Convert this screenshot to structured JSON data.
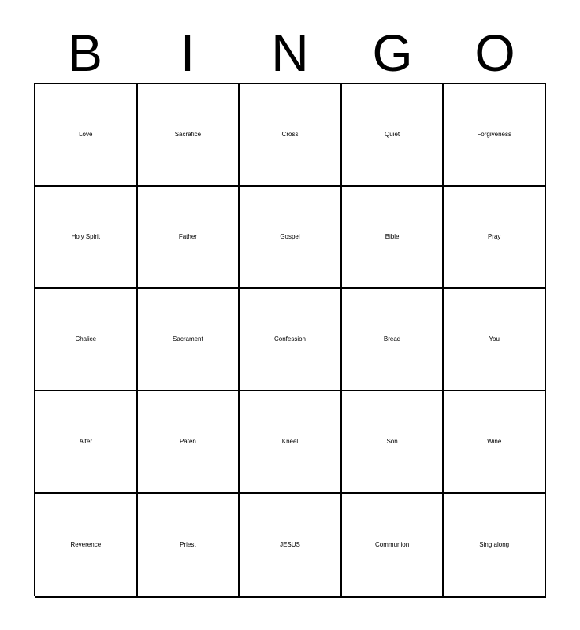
{
  "card": {
    "header_letters": [
      "B",
      "I",
      "N",
      "G",
      "O"
    ],
    "columns": 5,
    "rows": 5,
    "background_color": "#ffffff",
    "border_color": "#000000",
    "text_color": "#000000",
    "cells": [
      [
        {
          "text": "Love",
          "size": "xxl"
        },
        {
          "text": "Sacrafice",
          "size": "sm"
        },
        {
          "text": "Cross",
          "size": "xl"
        },
        {
          "text": "Quiet",
          "size": "xl"
        },
        {
          "text": "Forgiveness",
          "size": "xxs"
        }
      ],
      [
        {
          "text": "Holy Spirit",
          "size": "lg",
          "lines": 2
        },
        {
          "text": "Father",
          "size": "md"
        },
        {
          "text": "Gospel",
          "size": "md"
        },
        {
          "text": "Bible",
          "size": "xl"
        },
        {
          "text": "Pray",
          "size": "xl"
        }
      ],
      [
        {
          "text": "Chalice",
          "size": "md"
        },
        {
          "text": "Sacrament",
          "size": "xs"
        },
        {
          "text": "Confession",
          "size": "xxs"
        },
        {
          "text": "Bread",
          "size": "xl"
        },
        {
          "text": "You",
          "size": "xl"
        }
      ],
      [
        {
          "text": "Alter",
          "size": "xl"
        },
        {
          "text": "Paten",
          "size": "xl"
        },
        {
          "text": "Kneel",
          "size": "xl"
        },
        {
          "text": "Son",
          "size": "xl"
        },
        {
          "text": "Wine",
          "size": "xl"
        }
      ],
      [
        {
          "text": "Reverence",
          "size": "xs"
        },
        {
          "text": "Priest",
          "size": "xl"
        },
        {
          "text": "JESUS",
          "size": "md"
        },
        {
          "text": "Communion",
          "size": "xs"
        },
        {
          "text": "Sing along",
          "size": "lg",
          "lines": 2
        }
      ]
    ]
  }
}
